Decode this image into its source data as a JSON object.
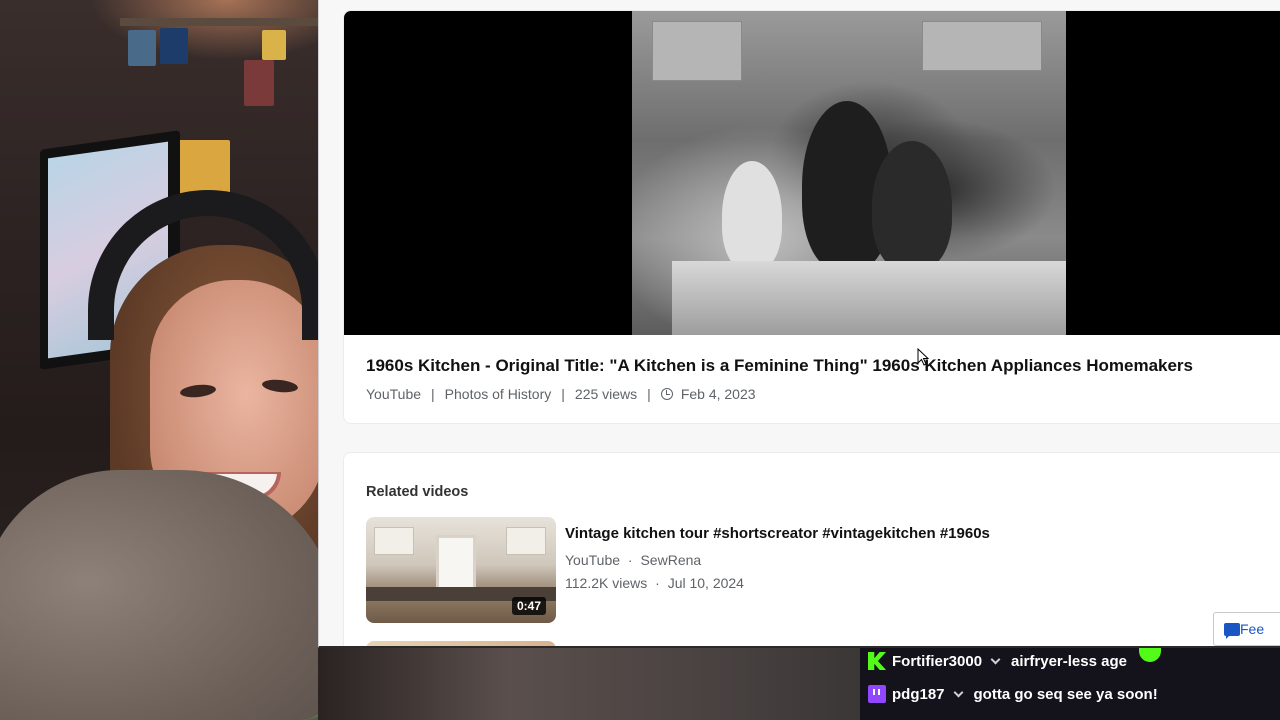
{
  "video": {
    "title": "1960s Kitchen - Original Title: \"A Kitchen is a Feminine Thing\" 1960s Kitchen Appliances Homemakers",
    "source": "YouTube",
    "channel": "Photos of History",
    "views": "225 views",
    "date": "Feb 4, 2023",
    "separator": "|",
    "date_icon": "clock-history-icon"
  },
  "related": {
    "heading": "Related videos",
    "items": [
      {
        "title": "Vintage kitchen tour #shortscreator #vintagekitchen #1960s",
        "source": "YouTube",
        "channel": "SewRena",
        "views": "112.2K views",
        "date": "Jul 10, 2024",
        "duration": "0:47",
        "dot": "·"
      }
    ]
  },
  "feedback": {
    "label": "Fee",
    "icon": "chat-bubble-icon"
  },
  "chat": {
    "messages": [
      {
        "platform": "kick",
        "user": "Fortifier3000",
        "text": "airfryer-less age",
        "user_color": "#ffffff"
      },
      {
        "platform": "twitch",
        "user": "pdg187",
        "text": "gotta go seq see ya soon!",
        "user_color": "#ffffff"
      }
    ]
  },
  "colors": {
    "kick": "#53fc18",
    "twitch": "#9146ff",
    "link_blue": "#1a55c4",
    "meta_gray": "#5f6368"
  }
}
